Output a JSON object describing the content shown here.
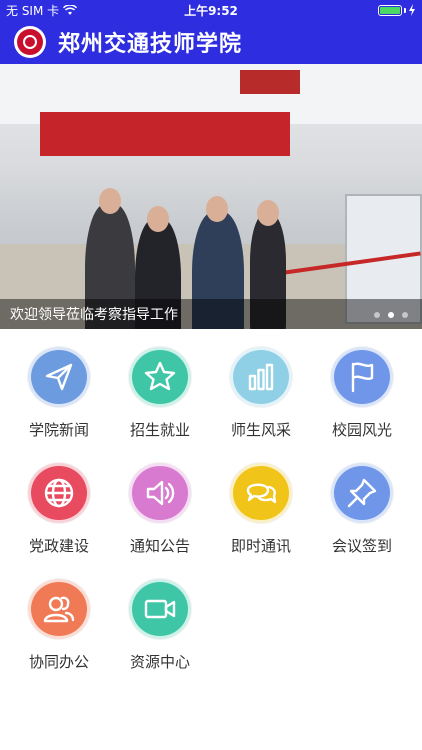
{
  "status_bar": {
    "carrier": "无 SIM 卡",
    "time": "上午9:52"
  },
  "header": {
    "title": "郑州交通技师学院"
  },
  "banner": {
    "caption": "欢迎领导莅临考察指导工作",
    "slide_count": 3,
    "active_slide": 2
  },
  "menu": [
    {
      "label": "学院新闻",
      "icon": "paper-plane-icon",
      "color": "#6d9be0"
    },
    {
      "label": "招生就业",
      "icon": "star-icon",
      "color": "#3fc6a6"
    },
    {
      "label": "师生风采",
      "icon": "bar-chart-icon",
      "color": "#8fd0e6"
    },
    {
      "label": "校园风光",
      "icon": "flag-icon",
      "color": "#6f96e8"
    },
    {
      "label": "党政建设",
      "icon": "globe-icon",
      "color": "#e84a5f"
    },
    {
      "label": "通知公告",
      "icon": "speaker-icon",
      "color": "#d77ad0"
    },
    {
      "label": "即时通讯",
      "icon": "chat-icon",
      "color": "#f0c419"
    },
    {
      "label": "会议签到",
      "icon": "pin-icon",
      "color": "#6f96e8"
    },
    {
      "label": "协同办公",
      "icon": "users-icon",
      "color": "#f07a55"
    },
    {
      "label": "资源中心",
      "icon": "video-icon",
      "color": "#3fc6a6"
    }
  ]
}
